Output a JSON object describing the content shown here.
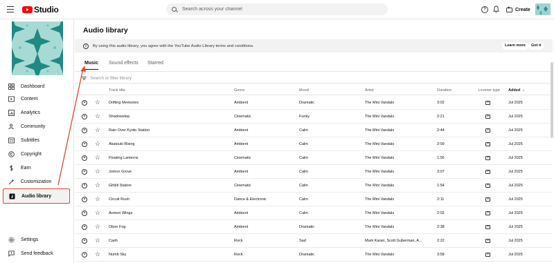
{
  "header": {
    "logo_text": "Studio",
    "search_placeholder": "Search across your channel",
    "help_glyph": "?",
    "create_label": "Create"
  },
  "sidebar": {
    "items": [
      {
        "label": "Dashboard",
        "icon": "dashboard-icon"
      },
      {
        "label": "Content",
        "icon": "content-icon"
      },
      {
        "label": "Analytics",
        "icon": "analytics-icon"
      },
      {
        "label": "Community",
        "icon": "community-icon"
      },
      {
        "label": "Subtitles",
        "icon": "subtitles-icon"
      },
      {
        "label": "Copyright",
        "icon": "copyright-icon"
      },
      {
        "label": "Earn",
        "icon": "earn-icon"
      },
      {
        "label": "Customization",
        "icon": "customization-icon"
      },
      {
        "label": "Audio library",
        "icon": "audio-library-icon"
      }
    ],
    "bottom": [
      {
        "label": "Settings",
        "icon": "gear-icon"
      },
      {
        "label": "Send feedback",
        "icon": "feedback-icon"
      }
    ]
  },
  "main": {
    "title": "Audio library",
    "banner_text": "By using this audio library, you agree with the YouTube Audio Library terms and conditions.",
    "banner_learn_more": "Learn more",
    "banner_got_it": "Got it",
    "tabs": [
      "Music",
      "Sound effects",
      "Starred"
    ],
    "filter_placeholder": "Search or filter library",
    "columns": {
      "track_title": "Track title",
      "genre": "Genre",
      "mood": "Mood",
      "artist": "Artist",
      "duration": "Duration",
      "license": "License type",
      "added": "Added"
    },
    "sort_arrow": "↓",
    "tracks": [
      {
        "title": "Drifting Memories",
        "genre": "Ambient",
        "mood": "Dramatic",
        "artist": "The Mini Vandals",
        "duration": "3:02",
        "added": "Jul 2025"
      },
      {
        "title": "Shadowstep",
        "genre": "Cinematic",
        "mood": "Funky",
        "artist": "The Mini Vandals",
        "duration": "2:21",
        "added": "Jul 2025"
      },
      {
        "title": "Rain Over Kyoto Station",
        "genre": "Ambient",
        "mood": "Calm",
        "artist": "The Mini Vandals",
        "duration": "2:44",
        "added": "Jul 2025"
      },
      {
        "title": "Akatsuki Rising",
        "genre": "Ambient",
        "mood": "Calm",
        "artist": "The Mini Vandals",
        "duration": "2:09",
        "added": "Jul 2025"
      },
      {
        "title": "Floating Lanterns",
        "genre": "Cinematic",
        "mood": "Calm",
        "artist": "The Mini Vandals",
        "duration": "1:56",
        "added": "Jul 2025"
      },
      {
        "title": "Jomon Grove",
        "genre": "Ambient",
        "mood": "Calm",
        "artist": "The Mini Vandals",
        "duration": "3:07",
        "added": "Jul 2025"
      },
      {
        "title": "Ghibli Station",
        "genre": "Cinematic",
        "mood": "Calm",
        "artist": "The Mini Vandals",
        "duration": "1:54",
        "added": "Jul 2025"
      },
      {
        "title": "Circuit Rush",
        "genre": "Dance & Electronic",
        "mood": "Calm",
        "artist": "The Mini Vandals",
        "duration": "2:11",
        "added": "Jul 2025"
      },
      {
        "title": "Aomori Wings",
        "genre": "Ambient",
        "mood": "Calm",
        "artist": "The Mini Vandals",
        "duration": "2:02",
        "added": "Jul 2025"
      },
      {
        "title": "Obon Fog",
        "genre": "Ambient",
        "mood": "Dramatic",
        "artist": "The Mini Vandals",
        "duration": "2:38",
        "added": "Jul 2025"
      },
      {
        "title": "Cash",
        "genre": "Rock",
        "mood": "Sad",
        "artist": "Mark Karan, Scott Guberman, A...",
        "duration": "2:22",
        "added": "Jul 2025"
      },
      {
        "title": "Numb Sky",
        "genre": "Rock",
        "mood": "Dramatic",
        "artist": "The Mini Vandals",
        "duration": "3:58",
        "added": "Jul 2025"
      }
    ]
  },
  "colors": {
    "brand_red": "#ff0000",
    "annotation_red": "#e5462e",
    "channel_teal": "#7cc4c0"
  }
}
